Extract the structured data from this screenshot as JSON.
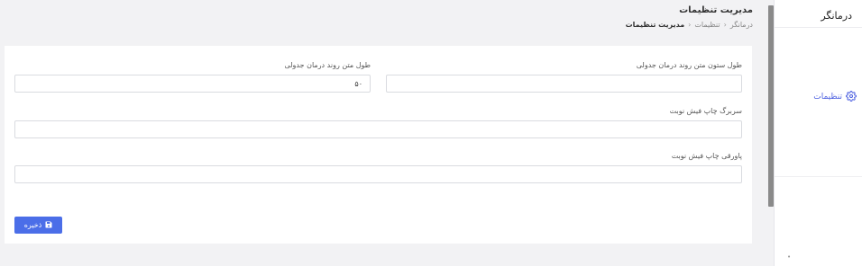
{
  "app": {
    "name": "درمانگر"
  },
  "sidebar": {
    "items": [
      {
        "label": "تنظیمات",
        "icon": "gear-icon",
        "active": true
      }
    ]
  },
  "header": {
    "title": "مدیریت تنظیمات",
    "breadcrumb": [
      "درمانگر",
      "تنظیمات",
      "مدیریت تنظیمات"
    ],
    "breadcrumb_separator": "‹"
  },
  "form": {
    "field_table_col_length": {
      "label": "طول ستون متن روند درمان جدولی",
      "value": ""
    },
    "field_table_text_length": {
      "label": "طول متن روند درمان جدولی",
      "value": "۵۰"
    },
    "field_print_header": {
      "label": "سربرگ چاپ فیش نوبت",
      "value": ""
    },
    "field_print_footer": {
      "label": "پاورقی چاپ فیش نوبت",
      "value": ""
    },
    "save_label": "ذخیره"
  },
  "colors": {
    "accent": "#4b6ee8",
    "sidebar_active": "#4b5fe0",
    "background": "#f2f2f4"
  }
}
